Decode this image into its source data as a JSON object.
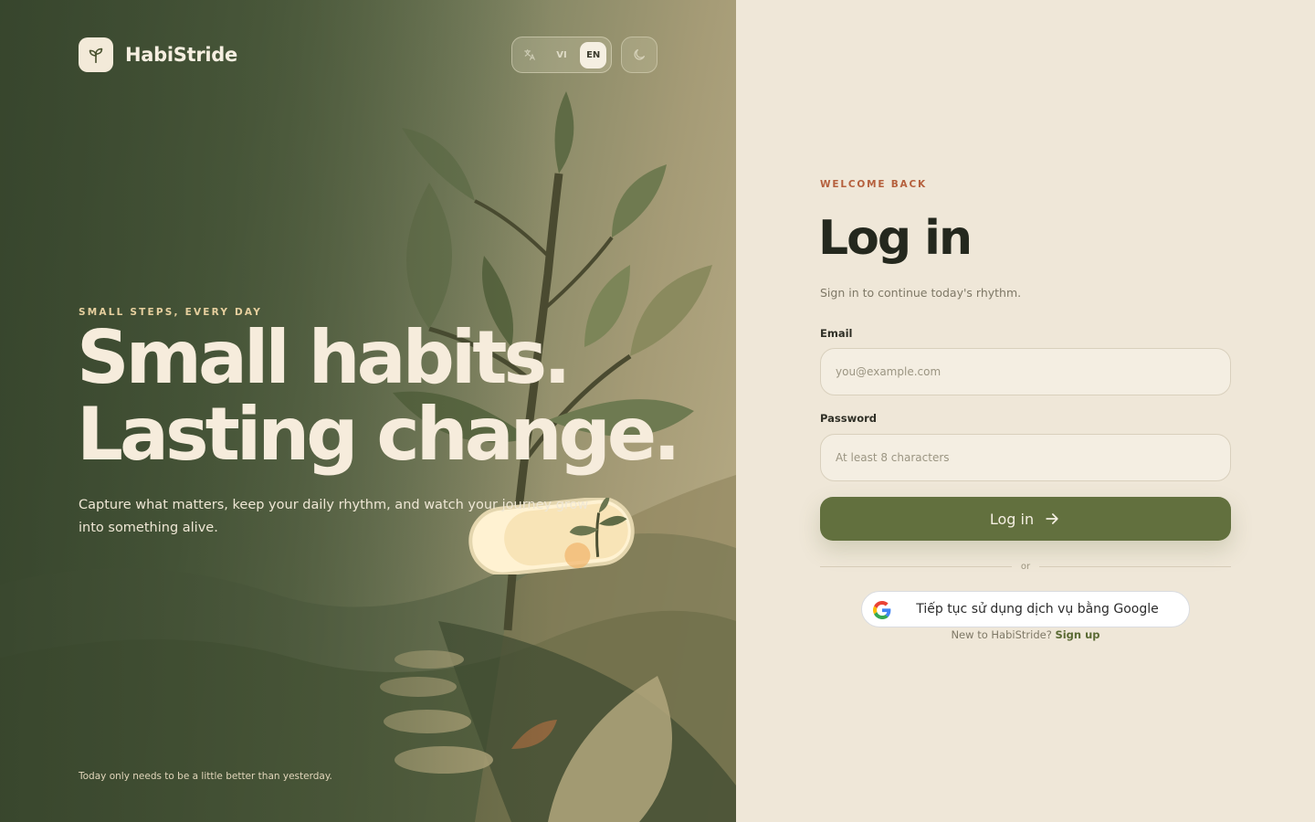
{
  "brand": {
    "name": "HabiStride",
    "logo_icon": "sprout-icon"
  },
  "language": {
    "options": [
      "VI",
      "EN"
    ],
    "selected": "EN",
    "translate_icon": "translate-icon"
  },
  "theme": {
    "icon": "moon-icon"
  },
  "hero": {
    "eyebrow": "SMALL STEPS, EVERY DAY",
    "headline_line1": "Small habits.",
    "headline_line2": "Lasting change.",
    "subtitle": "Capture what matters, keep your daily rhythm, and watch your journey grow into something alive.",
    "footer": "Today only needs to be a little better than yesterday."
  },
  "form": {
    "eyebrow": "WELCOME BACK",
    "title": "Log in",
    "subtitle": "Sign in to continue today's rhythm.",
    "email_label": "Email",
    "email_placeholder": "you@example.com",
    "email_value": "",
    "password_label": "Password",
    "password_placeholder": "At least 8 characters",
    "password_value": "",
    "submit_label": "Log in",
    "divider_text": "or",
    "google_label": "Tiếp tục sử dụng dịch vụ bằng Google",
    "signup_prompt": "New to HabiStride?",
    "signup_link": "Sign up"
  },
  "colors": {
    "accent": "#62703e",
    "eyebrow": "#b5603d",
    "panel_bg": "#efe7d8",
    "hero_text": "#f6ecdc"
  }
}
